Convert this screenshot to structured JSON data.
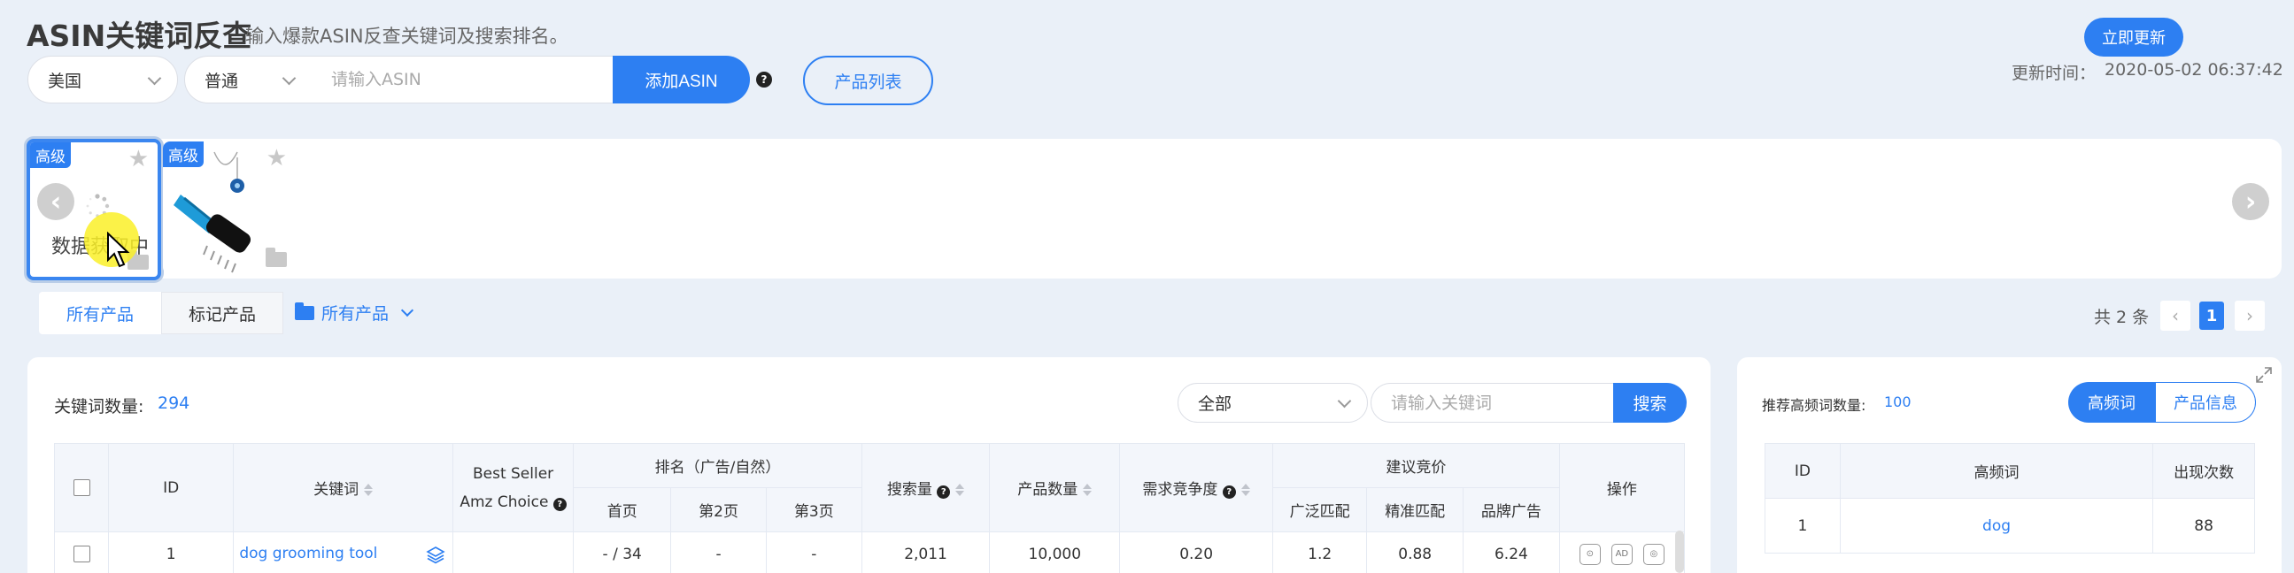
{
  "header": {
    "title": "ASIN关键词反查",
    "subtitle": "输入爆款ASIN反查关键词及搜索排名。",
    "refresh_label": "立即更新",
    "update_label": "更新时间：",
    "update_time": "2020-05-02 06:37:42"
  },
  "controls": {
    "country": "美国",
    "mode": "普通",
    "asin_placeholder": "请输入ASIN",
    "add_label": "添加ASIN",
    "help": "?",
    "product_list_label": "产品列表"
  },
  "products": [
    {
      "badge": "高级",
      "status": "数据获取中",
      "starred": false
    },
    {
      "badge": "高级",
      "starred": false
    }
  ],
  "filters": {
    "tab_all": "所有产品",
    "tab_marked": "标记产品",
    "folder_label": "所有产品",
    "total": "共 2 条",
    "current_page": "1"
  },
  "keywords": {
    "count_label": "关键词数量:",
    "count": "294",
    "filter_value": "全部",
    "search_placeholder": "请输入关键词",
    "search_label": "搜索",
    "headers": {
      "id": "ID",
      "keyword": "关键词",
      "best_seller": "Best Seller",
      "amz_choice": "Amz Choice",
      "rank_group": "排名（广告/自然）",
      "page1": "首页",
      "page2": "第2页",
      "page3": "第3页",
      "search_volume": "搜索量",
      "product_count": "产品数量",
      "demand_competition": "需求竞争度",
      "bid_group": "建议竞价",
      "broad": "广泛匹配",
      "exact": "精准匹配",
      "brand": "品牌广告",
      "action": "操作"
    },
    "rows": [
      {
        "id": "1",
        "keyword": "dog grooming tool",
        "best_seller": "",
        "page1": "- / 34",
        "page2": "-",
        "page3": "-",
        "search_volume": "2,011",
        "product_count": "10,000",
        "demand_competition": "0.20",
        "broad": "1.2",
        "exact": "0.88",
        "brand": "6.24",
        "action_icons": [
          "track-icon",
          "ad-icon",
          "chart-icon"
        ]
      }
    ]
  },
  "high_freq": {
    "count_label": "推荐高频词数量:",
    "count": "100",
    "tab_hf": "高频词",
    "tab_info": "产品信息",
    "headers": {
      "id": "ID",
      "word": "高频词",
      "occurrences": "出现次数"
    },
    "rows": [
      {
        "id": "1",
        "word": "dog",
        "occurrences": "88"
      }
    ]
  },
  "colors": {
    "accent": "#2d7ff2",
    "background": "#eaf0f8"
  }
}
